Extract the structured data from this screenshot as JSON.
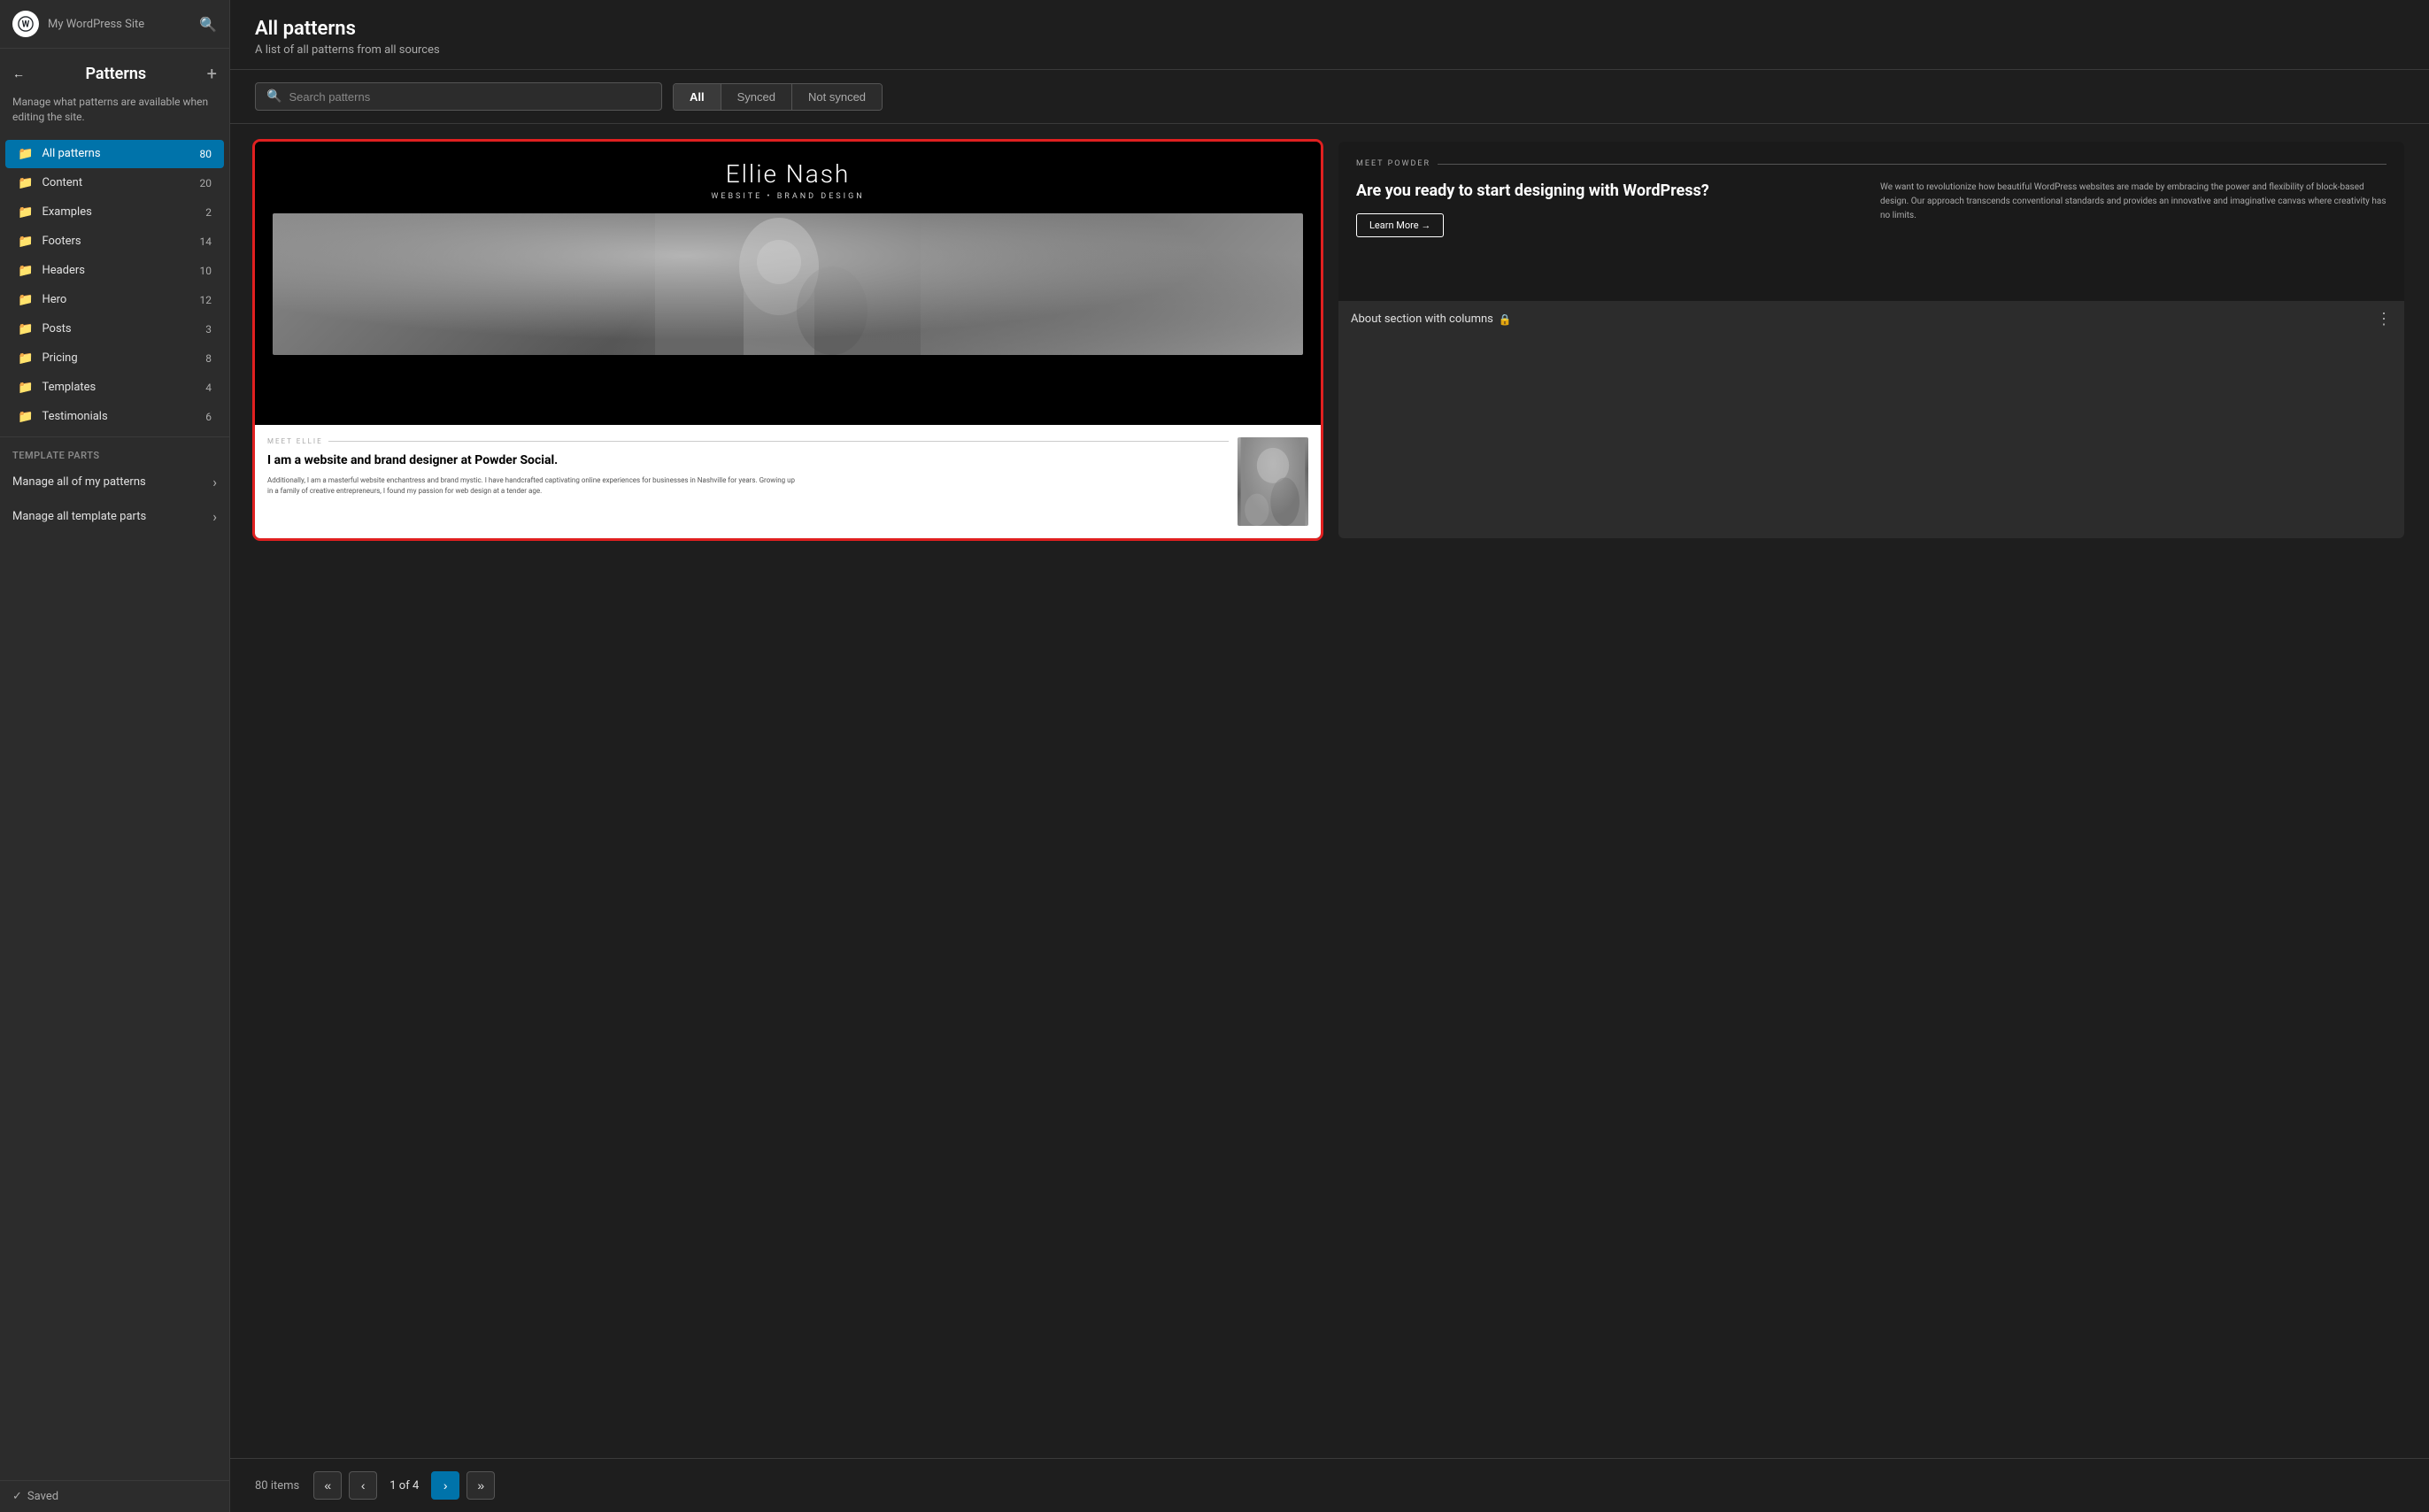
{
  "sidebar": {
    "logo": "W",
    "site_name": "My WordPress Site",
    "back_label": "back",
    "title": "Patterns",
    "add_btn": "+",
    "description": "Manage what patterns are available when editing the site.",
    "nav_items": [
      {
        "id": "all-patterns",
        "label": "All patterns",
        "count": "80",
        "active": true
      },
      {
        "id": "content",
        "label": "Content",
        "count": "20",
        "active": false
      },
      {
        "id": "examples",
        "label": "Examples",
        "count": "2",
        "active": false
      },
      {
        "id": "footers",
        "label": "Footers",
        "count": "14",
        "active": false
      },
      {
        "id": "headers",
        "label": "Headers",
        "count": "10",
        "active": false
      },
      {
        "id": "hero",
        "label": "Hero",
        "count": "12",
        "active": false
      },
      {
        "id": "posts",
        "label": "Posts",
        "count": "3",
        "active": false
      },
      {
        "id": "pricing",
        "label": "Pricing",
        "count": "8",
        "active": false
      },
      {
        "id": "templates",
        "label": "Templates",
        "count": "4",
        "active": false
      },
      {
        "id": "testimonials",
        "label": "Testimonials",
        "count": "6",
        "active": false
      }
    ],
    "section_label": "Template Parts",
    "link_items": [
      {
        "id": "manage-patterns",
        "label": "Manage all of my patterns"
      },
      {
        "id": "manage-template-parts",
        "label": "Manage all template parts"
      }
    ],
    "saved_status": "Saved"
  },
  "main": {
    "title": "All patterns",
    "subtitle": "A list of all patterns from all sources",
    "search_placeholder": "Search patterns",
    "filter_buttons": [
      {
        "id": "all",
        "label": "All",
        "active": true
      },
      {
        "id": "synced",
        "label": "Synced",
        "active": false
      },
      {
        "id": "not-synced",
        "label": "Not synced",
        "active": false
      }
    ],
    "patterns": [
      {
        "id": "ellie-nash",
        "name": "Ellie Nash",
        "selected": true,
        "preview_type": "ellie-nash",
        "title": "Ellie Nash",
        "subtitle": "WEBSITE • BRAND DESIGN",
        "about_meet_label": "MEET ELLIE",
        "about_heading": "I am a website and brand designer at Powder Social.",
        "about_body": "Additionally, I am a masterful website enchantress and brand mystic. I have handcrafted captivating online experiences for businesses in Nashville for years. Growing up in a family of creative entrepreneurs, I found my passion for web design at a tender age."
      },
      {
        "id": "about-section",
        "name": "About section with columns",
        "selected": false,
        "preview_type": "about-section",
        "meet_label": "MEET POWDER",
        "heading": "Are you ready to start designing with WordPress?",
        "body_text": "We want to revolutionize how beautiful WordPress websites are made by embracing the power and flexibility of block-based design. Our approach transcends conventional standards and provides an innovative and imaginative canvas where creativity has no limits.",
        "learn_more": "Learn More →",
        "has_lock": true
      }
    ],
    "pagination": {
      "count": "80 items",
      "first_btn": "«",
      "prev_btn": "‹",
      "current": "1 of 4",
      "next_btn": "›",
      "last_btn": "»"
    }
  }
}
